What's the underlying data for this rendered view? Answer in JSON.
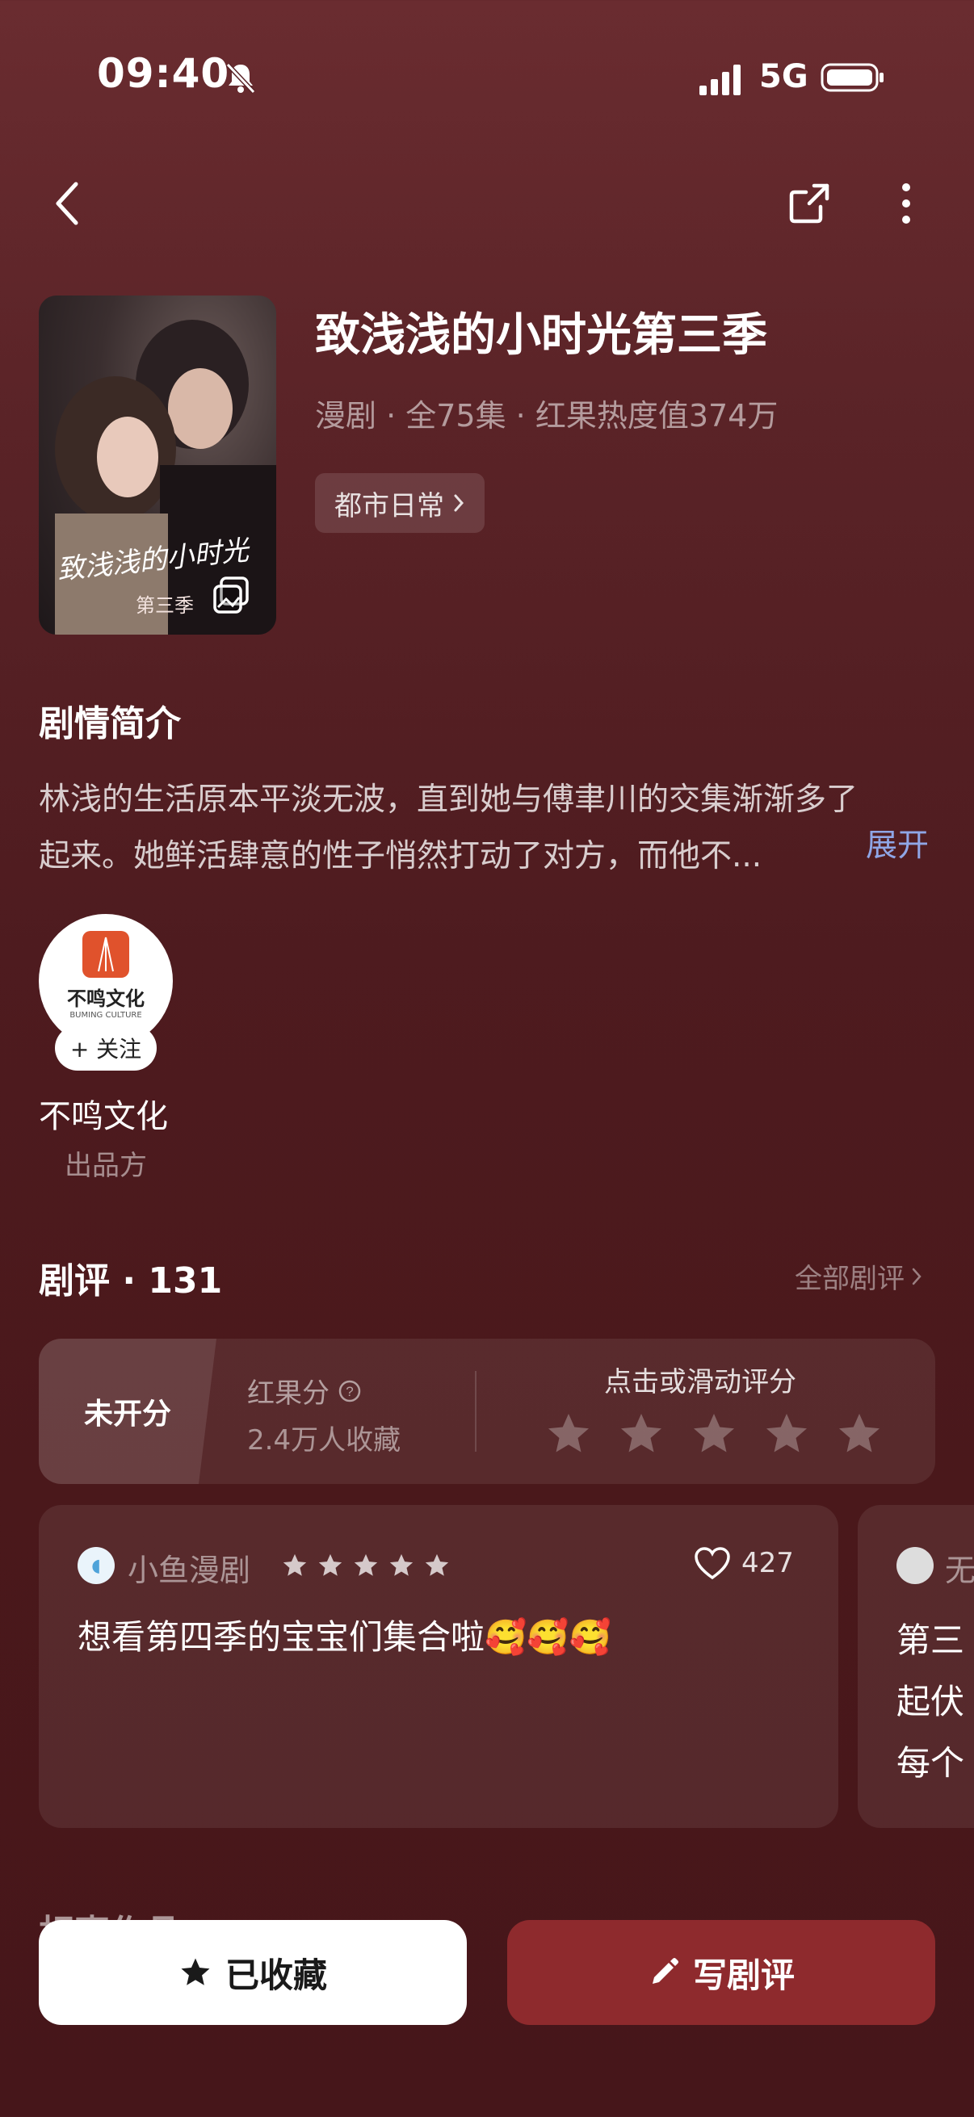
{
  "status": {
    "time": "09:40",
    "network": "5G"
  },
  "show": {
    "title": "致浅浅的小时光第三季",
    "meta": "漫剧 · 全75集 · 红果热度值374万",
    "tag": "都市日常",
    "cover_text": "致浅浅的小时光",
    "cover_sub": "第三季"
  },
  "synopsis": {
    "title": "剧情简介",
    "line1": "林浅的生活原本平淡无波，直到她与傅聿川的交集渐渐多了",
    "line2": "起来。她鲜活肆意的性子悄然打动了对方，而他不...",
    "expand": "展开"
  },
  "producer": {
    "logo_text": "不鸣文化",
    "logo_sub": "BUMING CULTURE",
    "follow": "+ 关注",
    "name": "不鸣文化",
    "role": "出品方"
  },
  "reviews": {
    "title": "剧评 · 131",
    "all": "全部剧评",
    "rating_status": "未开分",
    "rating_label": "红果分",
    "collect_count": "2.4万人收藏",
    "rate_hint": "点击或滑动评分",
    "items": [
      {
        "user": "小鱼漫剧",
        "stars": 5,
        "likes": "427",
        "text": "想看第四季的宝宝们集合啦🥰🥰🥰"
      },
      {
        "user": "无",
        "lines": [
          "第三",
          "起伏",
          "每个"
        ]
      }
    ]
  },
  "next_section_heading": "相声作品",
  "actions": {
    "collect": "已收藏",
    "write": "写剧评"
  },
  "colors": {
    "accent_link": "#8fa6e6",
    "write_button": "#8e2a2d",
    "background": "#4e1b1f"
  }
}
